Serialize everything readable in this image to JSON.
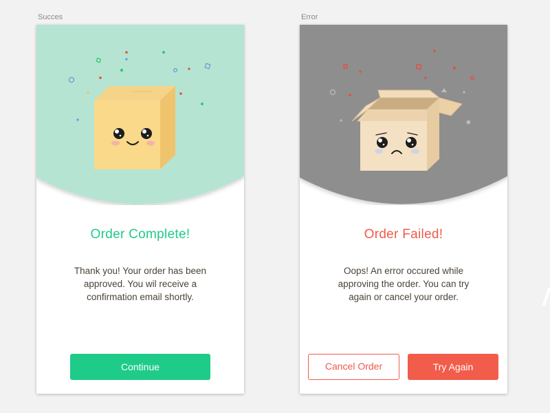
{
  "success": {
    "artboard_label": "Succes",
    "title": "Order Complete!",
    "message_lines": [
      "Thank you! Your order has been",
      "approved. You wil receive a",
      "confirmation email shortly."
    ],
    "button_label": "Continue",
    "colors": {
      "header": "#b6e4d3",
      "title": "#1fcb88",
      "button": "#1fcb88"
    }
  },
  "error": {
    "artboard_label": "Error",
    "title": "Order Failed!",
    "message_lines": [
      "Oops! An error occured while",
      "approving the order. You can try",
      "again or cancel your order."
    ],
    "cancel_label": "Cancel Order",
    "retry_label": "Try Again",
    "colors": {
      "header": "#8e8e8e",
      "title": "#f05a4a",
      "button": "#f25c4a"
    }
  },
  "icons": {
    "happy_box": "happy-box-illustration",
    "sad_box": "sad-open-box-illustration",
    "confetti": "confetti"
  }
}
